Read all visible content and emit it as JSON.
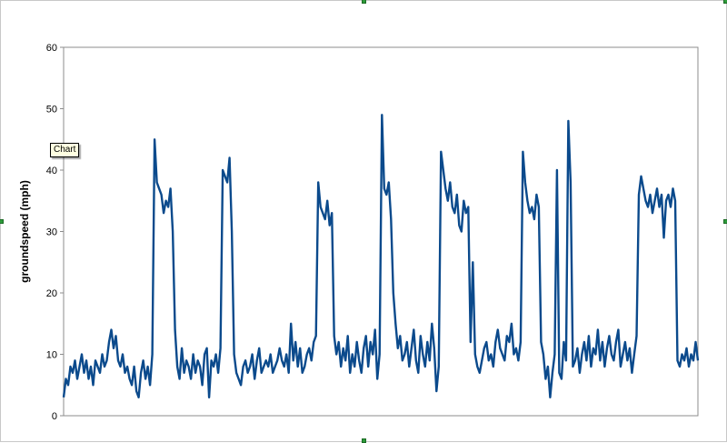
{
  "tooltip": {
    "text": "Chart"
  },
  "colors": {
    "series": "#0b4a8c",
    "plot_border": "#8c8c8c",
    "handle": "#2e9b3a"
  },
  "chart_data": {
    "type": "line",
    "title": "",
    "xlabel": "",
    "ylabel": "groundspeed (mph)",
    "ylim": [
      0,
      60
    ],
    "yticks": [
      0,
      10,
      20,
      30,
      40,
      50,
      60
    ],
    "grid": false,
    "legend": "none",
    "series": [
      {
        "values": [
          3,
          6,
          5,
          8,
          7,
          9,
          6,
          8,
          10,
          7,
          9,
          6,
          8,
          5,
          9,
          8,
          7,
          10,
          8,
          9,
          12,
          14,
          11,
          13,
          9,
          8,
          10,
          7,
          8,
          6,
          5,
          8,
          4,
          3,
          7,
          9,
          6,
          8,
          5,
          10,
          45,
          38,
          37,
          36,
          33,
          35,
          34,
          37,
          30,
          14,
          8,
          6,
          11,
          7,
          9,
          8,
          6,
          10,
          7,
          9,
          8,
          5,
          10,
          11,
          3,
          9,
          8,
          10,
          7,
          11,
          40,
          39,
          38,
          42,
          30,
          10,
          7,
          6,
          5,
          8,
          9,
          7,
          8,
          10,
          6,
          9,
          11,
          7,
          8,
          9,
          8,
          10,
          7,
          8,
          9,
          11,
          9,
          8,
          10,
          7,
          15,
          9,
          12,
          8,
          11,
          7,
          8,
          10,
          11,
          9,
          12,
          13,
          38,
          34,
          33,
          32,
          35,
          31,
          33,
          13,
          10,
          12,
          8,
          11,
          9,
          13,
          7,
          10,
          8,
          12,
          9,
          7,
          11,
          13,
          8,
          12,
          10,
          14,
          6,
          10,
          49,
          37,
          36,
          38,
          32,
          20,
          15,
          11,
          13,
          9,
          10,
          12,
          8,
          11,
          14,
          9,
          7,
          13,
          10,
          8,
          12,
          9,
          15,
          11,
          4,
          8,
          43,
          40,
          37,
          35,
          38,
          34,
          33,
          36,
          31,
          30,
          35,
          33,
          34,
          12,
          25,
          10,
          8,
          7,
          9,
          11,
          12,
          9,
          10,
          8,
          12,
          14,
          11,
          10,
          9,
          13,
          12,
          15,
          10,
          11,
          9,
          12,
          43,
          38,
          35,
          33,
          34,
          32,
          36,
          34,
          12,
          10,
          6,
          8,
          3,
          7,
          10,
          40,
          7,
          6,
          12,
          9,
          48,
          38,
          8,
          9,
          11,
          7,
          10,
          12,
          9,
          13,
          8,
          11,
          10,
          14,
          9,
          12,
          8,
          11,
          13,
          10,
          9,
          12,
          14,
          8,
          10,
          12,
          9,
          11,
          7,
          10,
          13,
          36,
          39,
          37,
          35,
          34,
          36,
          33,
          35,
          37,
          34,
          36,
          29,
          35,
          36,
          34,
          37,
          35,
          9,
          8,
          10,
          9,
          11,
          8,
          10,
          9,
          12,
          9
        ]
      }
    ]
  }
}
